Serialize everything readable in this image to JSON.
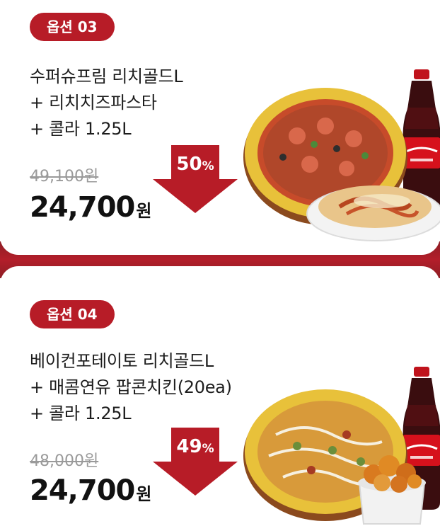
{
  "options": [
    {
      "badge": "옵션 03",
      "title_lines": [
        "수퍼슈프림 리치골드L",
        "+ 리치치즈파스타",
        "+ 콜라 1.25L"
      ],
      "original_price": "49,100원",
      "discount_value": "50",
      "discount_unit": "%",
      "price_value": "24,700",
      "price_unit": "원",
      "side_item": "pasta"
    },
    {
      "badge": "옵션 04",
      "title_lines": [
        "베이컨포테이토 리치골드L",
        "+ 매콤연유 팝콘치킨(20ea)",
        "+ 콜라 1.25L"
      ],
      "original_price": "48,000원",
      "discount_value": "49",
      "discount_unit": "%",
      "price_value": "24,700",
      "price_unit": "원",
      "side_item": "popcorn-chicken"
    }
  ],
  "colors": {
    "accent_red": "#b71c27",
    "divider_band": "#a51d28",
    "text_dark": "#1d1d1d",
    "text_strike": "#9a9a9a"
  }
}
